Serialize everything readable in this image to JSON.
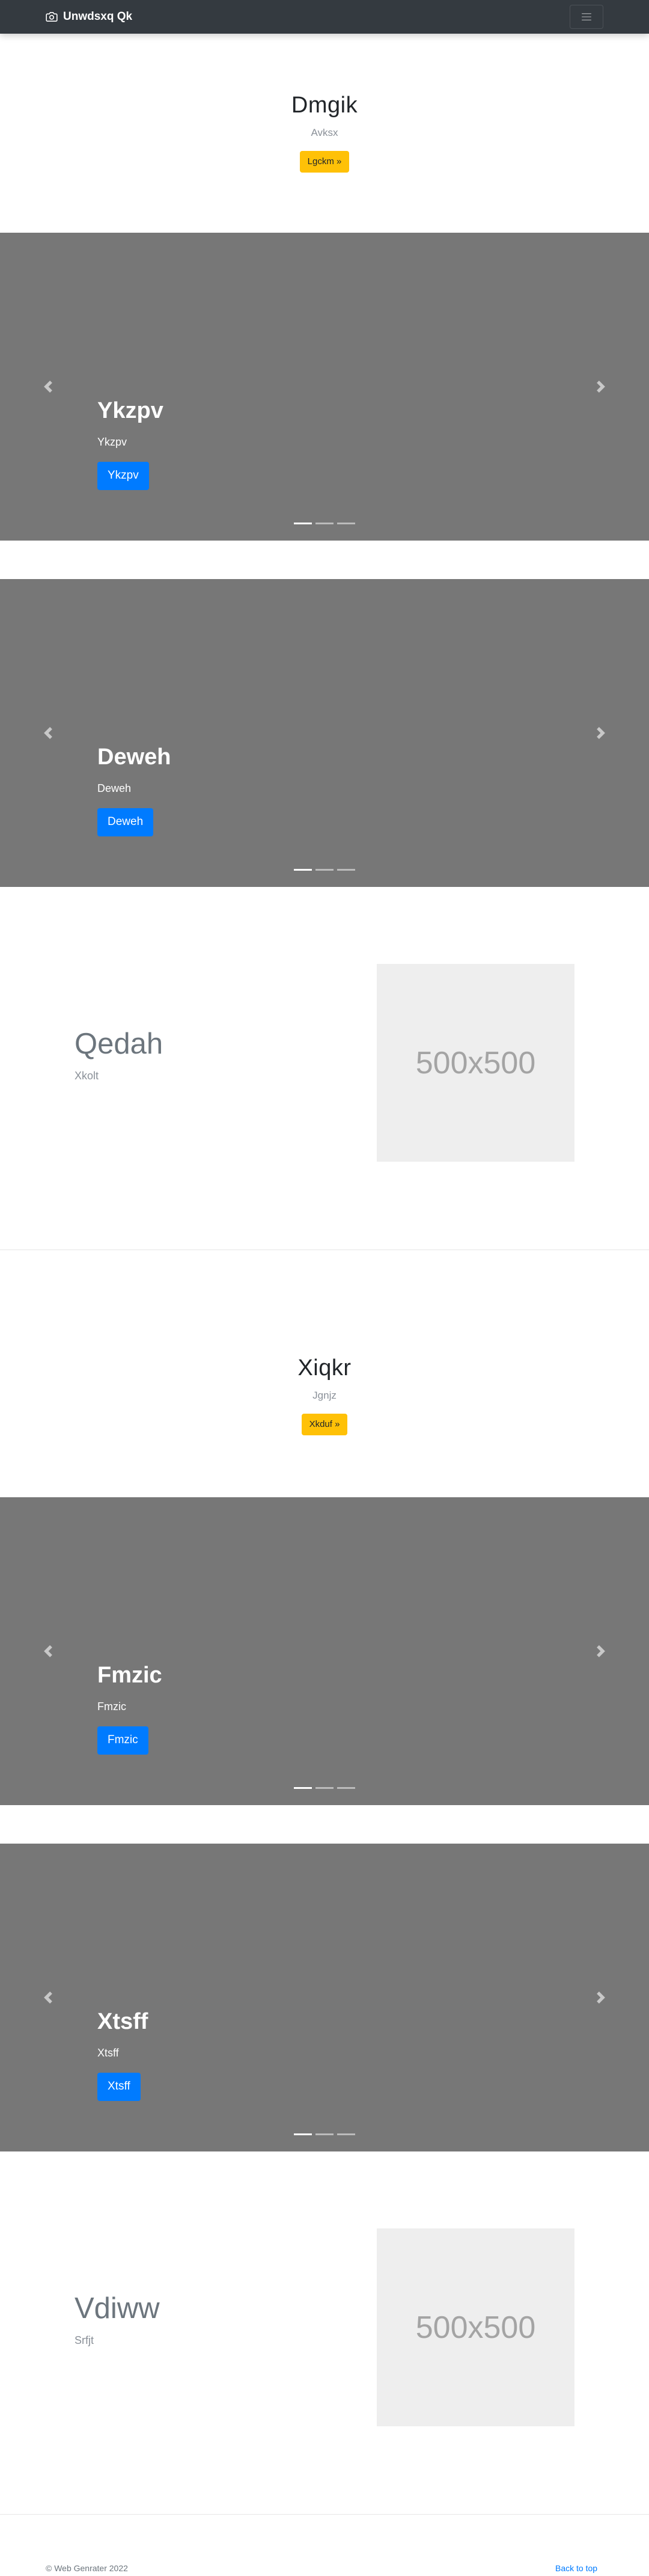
{
  "navbar": {
    "brand": "Unwdsxq Qk",
    "brand_icon": "camera-icon",
    "menu_icon": "hamburger-menu-icon"
  },
  "hero1": {
    "title": "Dmgik",
    "subtitle": "Avksx",
    "button": "Lgckm »"
  },
  "carousel1": {
    "title": "Ykzpv",
    "text": "Ykzpv",
    "button": "Ykzpv",
    "active_slide": 1,
    "slide_count": 3
  },
  "carousel2": {
    "title": "Deweh",
    "text": "Deweh",
    "button": "Deweh",
    "active_slide": 1,
    "slide_count": 3
  },
  "feature1": {
    "title": "Qedah",
    "subtitle": "Xkolt",
    "image_text": "500x500"
  },
  "hero2": {
    "title": "Xiqkr",
    "subtitle": "Jgnjz",
    "button": "Xkduf »"
  },
  "carousel3": {
    "title": "Fmzic",
    "text": "Fmzic",
    "button": "Fmzic",
    "active_slide": 1,
    "slide_count": 3
  },
  "carousel4": {
    "title": "Xtsff",
    "text": "Xtsff",
    "button": "Xtsff",
    "active_slide": 1,
    "slide_count": 3
  },
  "feature2": {
    "title": "Vdiww",
    "subtitle": "Srfjt",
    "image_text": "500x500"
  },
  "footer": {
    "copyright": "© Web Genrater 2022",
    "back_to_top": "Back to top"
  },
  "colors": {
    "navbar_bg": "#343a40",
    "carousel_bg": "#777777",
    "primary": "#007bff",
    "warning": "#ffc107",
    "placeholder_bg": "#eeeeee"
  }
}
